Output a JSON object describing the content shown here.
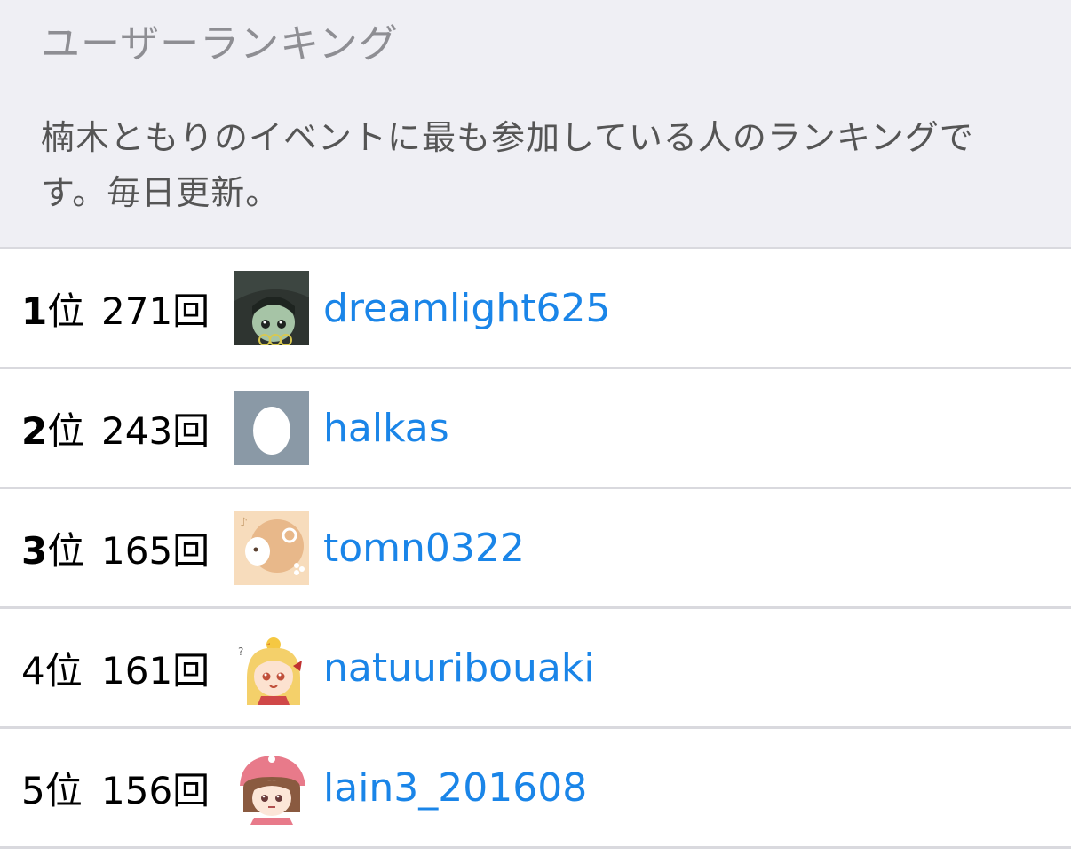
{
  "header": {
    "title": "ユーザーランキング",
    "description": "楠木ともりのイベントに最も参加している人のランキングです。毎日更新。"
  },
  "ranking": [
    {
      "rank": "1",
      "rank_suffix": "位",
      "count": "271回",
      "username": "dreamlight625",
      "avatar": "dark-hooded-character-avatar"
    },
    {
      "rank": "2",
      "rank_suffix": "位",
      "count": "243回",
      "username": "halkas",
      "avatar": "default-egg-avatar"
    },
    {
      "rank": "3",
      "rank_suffix": "位",
      "count": "165回",
      "username": "tomn0322",
      "avatar": "peach-sheep-avatar"
    },
    {
      "rank": "4",
      "rank_suffix": "位",
      "count": "161回",
      "username": "natuuribouaki",
      "avatar": "blonde-girl-chick-avatar"
    },
    {
      "rank": "5",
      "rank_suffix": "位",
      "count": "156回",
      "username": "lain3_201608",
      "avatar": "pink-cap-girl-avatar"
    }
  ],
  "colors": {
    "header_bg": "#efeff4",
    "link": "#1a85e8",
    "divider": "#d9d9de"
  }
}
